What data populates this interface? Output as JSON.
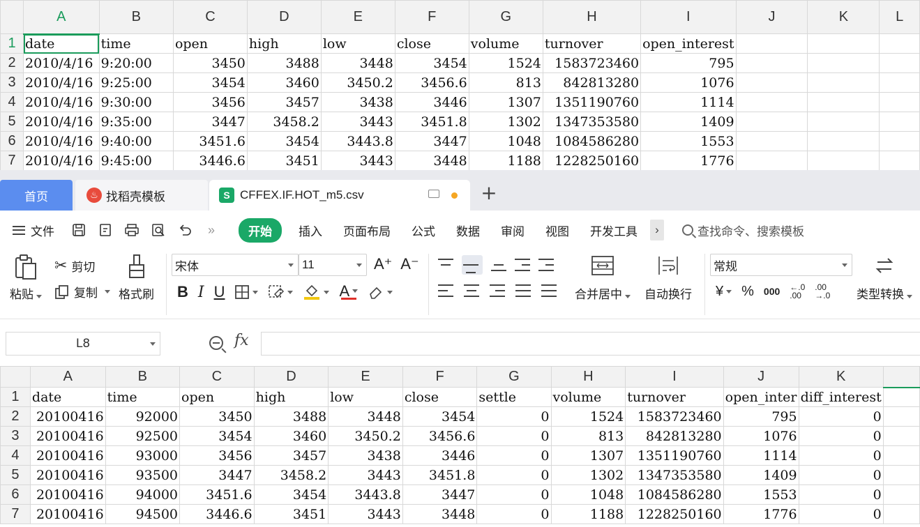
{
  "top_sheet": {
    "columns": [
      "A",
      "B",
      "C",
      "D",
      "E",
      "F",
      "G",
      "H",
      "I",
      "J",
      "K",
      "L"
    ],
    "active_column": "A",
    "active_row": "1",
    "selected_cell": "A1",
    "rows": [
      {
        "n": "1",
        "cells": [
          "date",
          "time",
          "open",
          "high",
          "low",
          "close",
          "volume",
          "turnover",
          "open_interest",
          "",
          "",
          ""
        ]
      },
      {
        "n": "2",
        "cells": [
          "2010/4/16",
          "9:20:00",
          "3450",
          "3488",
          "3448",
          "3454",
          "1524",
          "1583723460",
          "795",
          "",
          "",
          ""
        ]
      },
      {
        "n": "3",
        "cells": [
          "2010/4/16",
          "9:25:00",
          "3454",
          "3460",
          "3450.2",
          "3456.6",
          "813",
          "842813280",
          "1076",
          "",
          "",
          ""
        ]
      },
      {
        "n": "4",
        "cells": [
          "2010/4/16",
          "9:30:00",
          "3456",
          "3457",
          "3438",
          "3446",
          "1307",
          "1351190760",
          "1114",
          "",
          "",
          ""
        ]
      },
      {
        "n": "5",
        "cells": [
          "2010/4/16",
          "9:35:00",
          "3447",
          "3458.2",
          "3443",
          "3451.8",
          "1302",
          "1347353580",
          "1409",
          "",
          "",
          ""
        ]
      },
      {
        "n": "6",
        "cells": [
          "2010/4/16",
          "9:40:00",
          "3451.6",
          "3454",
          "3443.8",
          "3447",
          "1048",
          "1084586280",
          "1553",
          "",
          "",
          ""
        ]
      },
      {
        "n": "7",
        "cells": [
          "2010/4/16",
          "9:45:00",
          "3446.6",
          "3451",
          "3443",
          "3448",
          "1188",
          "1228250160",
          "1776",
          "",
          "",
          ""
        ]
      }
    ]
  },
  "tabs": {
    "home": "首页",
    "dao": "找稻壳模板",
    "file": "CFFEX.IF.HOT_m5.csv",
    "file_icon": "S",
    "add": "+"
  },
  "menu": {
    "file": "文件",
    "more_arrows": "»",
    "items": [
      "开始",
      "插入",
      "页面布局",
      "公式",
      "数据",
      "审阅",
      "视图",
      "开发工具"
    ],
    "more": "›",
    "search_placeholder": "查找命令、搜索模板"
  },
  "ribbon": {
    "paste": "粘贴",
    "cut": "剪切",
    "copy": "复制",
    "format_painter": "格式刷",
    "font_name": "宋体",
    "font_size": "11",
    "bold": "B",
    "italic": "I",
    "underline": "U",
    "font_color_glyph": "A",
    "merge_center": "合并居中",
    "wrap_text": "自动换行",
    "number_format": "常规",
    "currency": "¥",
    "percent": "%",
    "thousands": "000",
    "dec_inc": "←.0\n.00",
    "dec_dec": ".00\n→.0",
    "type_convert": "类型转换",
    "grow_font": "A⁺",
    "shrink_font": "A⁻"
  },
  "formula_bar": {
    "cell_ref": "L8",
    "fx": "fx",
    "value": ""
  },
  "bottom_sheet": {
    "columns": [
      "A",
      "B",
      "C",
      "D",
      "E",
      "F",
      "G",
      "H",
      "I",
      "J",
      "K",
      ""
    ],
    "active_column_index": 11,
    "rows": [
      {
        "n": "1",
        "cells": [
          "date",
          "time",
          "open",
          "high",
          "low",
          "close",
          "settle",
          "volume",
          "turnover",
          "open_inter",
          "diff_interest",
          ""
        ]
      },
      {
        "n": "2",
        "cells": [
          "20100416",
          "92000",
          "3450",
          "3488",
          "3448",
          "3454",
          "0",
          "1524",
          "1583723460",
          "795",
          "0",
          ""
        ]
      },
      {
        "n": "3",
        "cells": [
          "20100416",
          "92500",
          "3454",
          "3460",
          "3450.2",
          "3456.6",
          "0",
          "813",
          "842813280",
          "1076",
          "0",
          ""
        ]
      },
      {
        "n": "4",
        "cells": [
          "20100416",
          "93000",
          "3456",
          "3457",
          "3438",
          "3446",
          "0",
          "1307",
          "1351190760",
          "1114",
          "0",
          ""
        ]
      },
      {
        "n": "5",
        "cells": [
          "20100416",
          "93500",
          "3447",
          "3458.2",
          "3443",
          "3451.8",
          "0",
          "1302",
          "1347353580",
          "1409",
          "0",
          ""
        ]
      },
      {
        "n": "6",
        "cells": [
          "20100416",
          "94000",
          "3451.6",
          "3454",
          "3443.8",
          "3447",
          "0",
          "1048",
          "1084586280",
          "1553",
          "0",
          ""
        ]
      },
      {
        "n": "7",
        "cells": [
          "20100416",
          "94500",
          "3446.6",
          "3451",
          "3443",
          "3448",
          "0",
          "1188",
          "1228250160",
          "1776",
          "0",
          ""
        ]
      }
    ]
  },
  "colors": {
    "accent_green": "#1aa867",
    "home_tab_blue": "#5b8def",
    "modified_dot": "#f5a623"
  }
}
